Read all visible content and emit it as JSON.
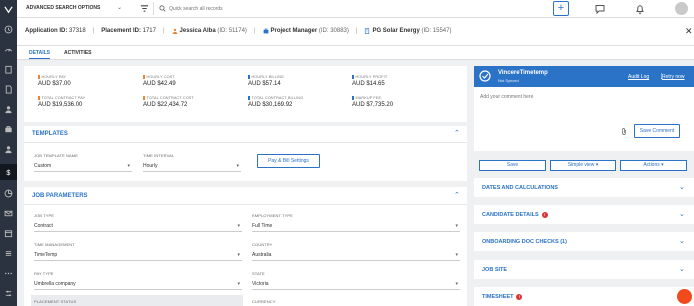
{
  "topbar": {
    "search_mode": "ADVANCED SEARCH OPTIONS",
    "search_placeholder": "Quick search all records",
    "plus_label": "+"
  },
  "header": {
    "application_label": "Application ID:",
    "application_id": "37318",
    "placement_label": "Placement ID:",
    "placement_id": "1717",
    "candidate_name": "Jessica Alba",
    "candidate_id": "(ID: 51174)",
    "job_title": "Project Manager",
    "job_id": "(ID: 30883)",
    "company_name": "PG Solar Energy",
    "company_id": "(ID: 15547)"
  },
  "tabs": [
    "DETAILS",
    "ACTIVITIES"
  ],
  "stats": [
    {
      "label": "HOURLY PAY",
      "value": "AUD $37.00",
      "color": "#e8873b"
    },
    {
      "label": "HOURLY COST",
      "value": "AUD $42.49",
      "color": "#e8873b"
    },
    {
      "label": "HOURLY BILLING",
      "value": "AUD $57.14",
      "color": "#2a73c7"
    },
    {
      "label": "HOURLY PROFIT",
      "value": "AUD $14.65",
      "color": "#2a73c7"
    },
    {
      "label": "TOTAL CONTRACT PAY",
      "value": "AUD $19,536.00",
      "color": "#e8873b"
    },
    {
      "label": "TOTAL CONTRACT COST",
      "value": "AUD $22,434.72",
      "color": "#e8873b"
    },
    {
      "label": "TOTAL CONTRACT BILLING",
      "value": "AUD $30,169.92",
      "color": "#2a73c7"
    },
    {
      "label": "MARKUP FEE",
      "value": "AUD $7,735.20",
      "color": "#2a73c7"
    }
  ],
  "templates": {
    "title": "TEMPLATES",
    "job_template_label": "JOB TEMPLATE NAME",
    "job_template_value": "Custom",
    "time_interval_label": "TIME INTERVAL",
    "time_interval_value": "Hourly",
    "pay_bill_button": "Pay & Bill Settings"
  },
  "job_parameters": {
    "title": "JOB PARAMETERS",
    "job_type_label": "JOB TYPE",
    "job_type_value": "Contract",
    "employment_type_label": "EMPLOYMENT TYPE",
    "employment_type_value": "Full Time",
    "time_management_label": "TIME MANAGEMENT",
    "time_management_value": "TimeTemp",
    "country_label": "COUNTRY",
    "country_value": "Australia",
    "pay_type_label": "PAY TYPE",
    "pay_type_value": "Umbrella company",
    "state_label": "STATE",
    "state_value": "Victoria",
    "placement_status_label": "PLACEMENT STATUS",
    "currency_label": "CURRENCY"
  },
  "right_panel": {
    "title": "VincereTimetemp",
    "subtitle": "Not Synced",
    "audit_log": "Audit Log",
    "retry_now": "Retry now",
    "comment_placeholder": "Add your comment here",
    "save_comment": "Save Comment",
    "save_button": "Save",
    "view_select": "Simple view",
    "actions_select": "Actions"
  },
  "accordions": [
    {
      "label": "DATES AND CALCULATIONS",
      "error": false
    },
    {
      "label": "CANDIDATE DETAILS",
      "error": true
    },
    {
      "label": "ONBOARDING DOC CHECKS (1)",
      "error": false
    },
    {
      "label": "JOB SITE",
      "error": false
    },
    {
      "label": "TIMESHEET",
      "error": true
    }
  ],
  "colors": {
    "accent": "#2a73c7",
    "sidebar": "#2b3340",
    "error": "#dd3333",
    "help": "#f04a1d"
  }
}
